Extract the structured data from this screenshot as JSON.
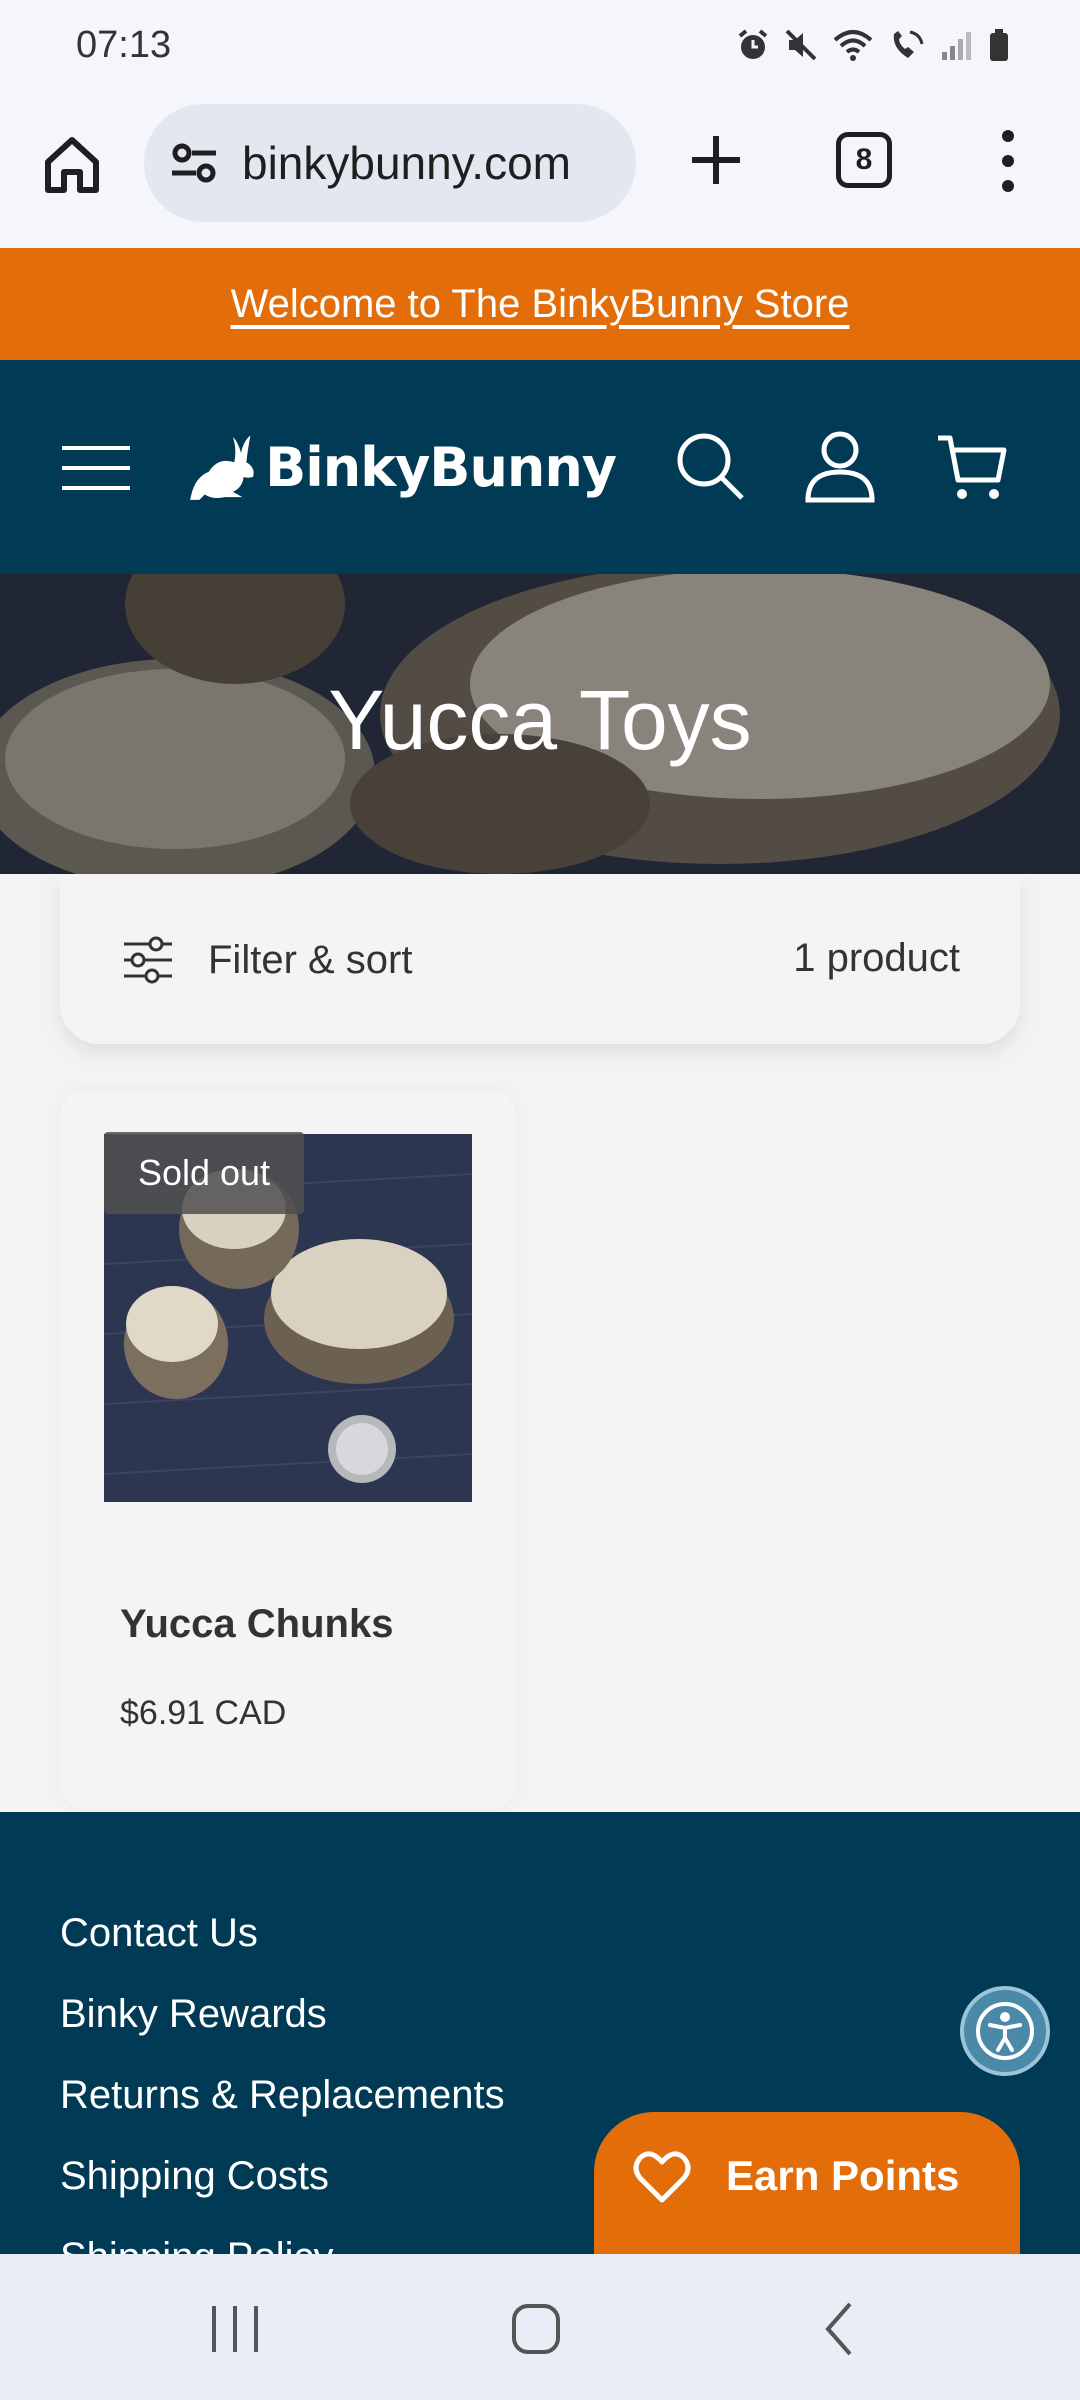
{
  "status_bar": {
    "time": "07:13",
    "icons": [
      "alarm-icon",
      "mute-icon",
      "wifi-icon",
      "wifi-calling-icon",
      "signal-icon",
      "battery-icon"
    ]
  },
  "browser": {
    "url": "binkybunny.com",
    "tab_count": "8",
    "icons": [
      "home-icon",
      "site-info-icon",
      "new-tab-icon",
      "more-options-icon"
    ]
  },
  "announcement": {
    "text": "Welcome to The BinkyBunny Store"
  },
  "header": {
    "logo_text": "BinkyBunny",
    "icons": [
      "menu-icon",
      "search-icon",
      "account-icon",
      "cart-icon"
    ]
  },
  "hero": {
    "title": "Yucca Toys"
  },
  "filter": {
    "label": "Filter & sort",
    "count": "1 product"
  },
  "products": [
    {
      "name": "Yucca Chunks",
      "price": "$6.91 CAD",
      "badge": "Sold out"
    }
  ],
  "footer": {
    "links": [
      "Contact Us",
      "Binky Rewards",
      "Returns & Replacements",
      "Shipping Costs",
      "Shipping Policy"
    ]
  },
  "rewards": {
    "label": "Earn Points"
  },
  "colors": {
    "brand_dark": "#003a54",
    "brand_orange": "#e36d08",
    "page_bg": "#f3f3f3"
  }
}
